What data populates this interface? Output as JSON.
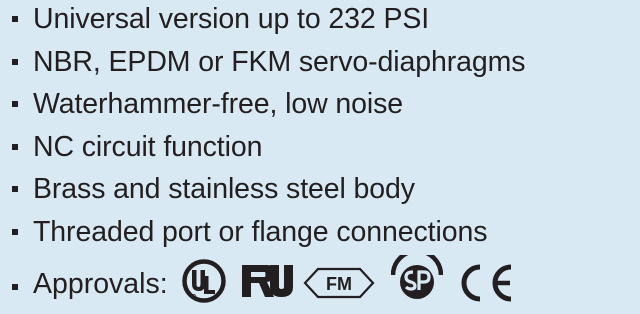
{
  "features": [
    "Universal version up to 232 PSI",
    "NBR, EPDM or FKM servo-diaphragms",
    "Waterhammer-free, low noise",
    "NC circuit function",
    "Brass and stainless steel body",
    "Threaded port or flange connections"
  ],
  "approvals": {
    "label": "Approvals:",
    "marks": [
      {
        "name": "ul-listed",
        "text": "UL"
      },
      {
        "name": "ul-recognized",
        "text": "RU"
      },
      {
        "name": "fm-approved",
        "text": "FM"
      },
      {
        "name": "csa",
        "text": "SP"
      },
      {
        "name": "ce",
        "text": "CE"
      }
    ]
  },
  "colors": {
    "background": "#d8e9f4",
    "text": "#231f20"
  }
}
